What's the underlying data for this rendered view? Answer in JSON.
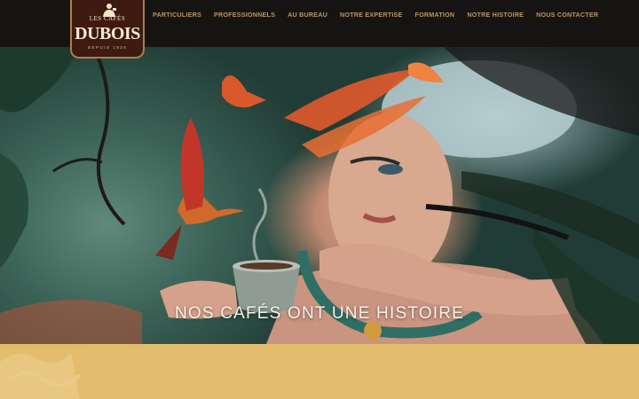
{
  "logo": {
    "top_text": "LES CAFÉS",
    "main_text": "DUBOIS",
    "sub_text": "DEPUIS 1926"
  },
  "nav": {
    "items": [
      "PARTICULIERS",
      "PROFESSIONNELS",
      "AU BUREAU",
      "NOTRE EXPERTISE",
      "FORMATION",
      "NOTRE HISTOIRE",
      "NOUS CONTACTER"
    ]
  },
  "hero": {
    "title": "NOS CAFÉS ONT UNE HISTOIRE"
  },
  "colors": {
    "header_bg": "#161412",
    "nav_text": "#b89660",
    "logo_bg": "#3e1a10",
    "band_bg": "#e3bd6d"
  }
}
